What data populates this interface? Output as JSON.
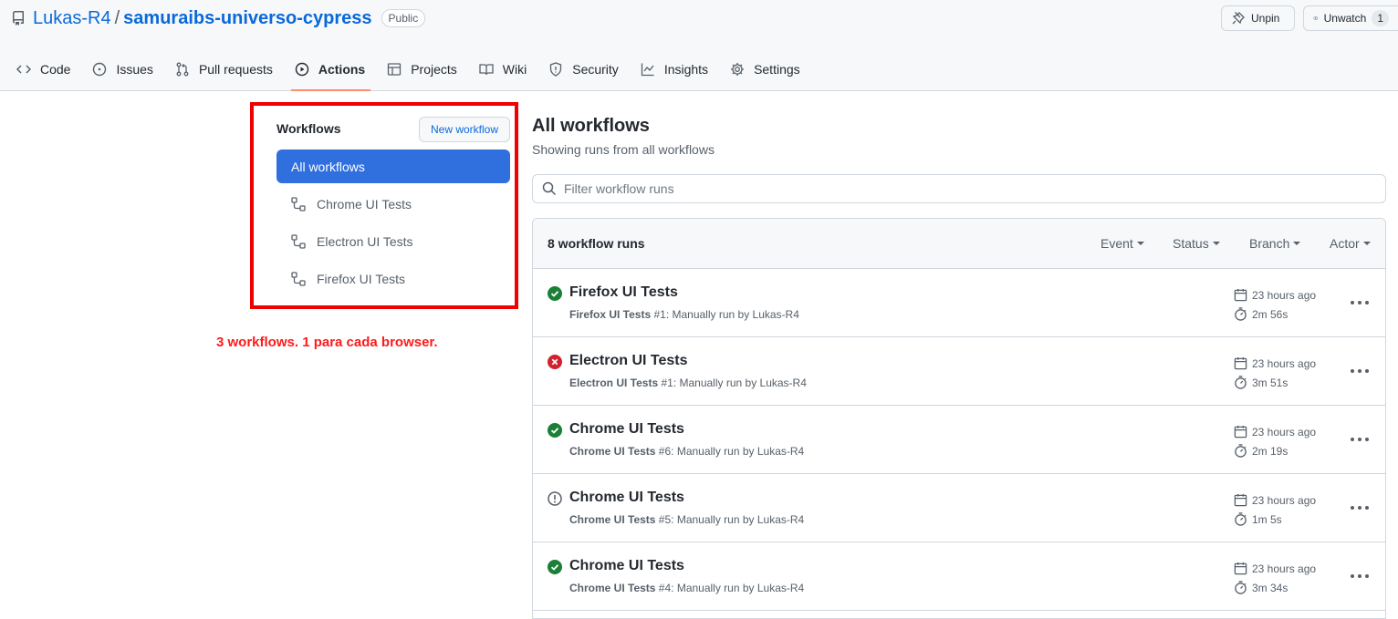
{
  "repo": {
    "owner": "Lukas-R4",
    "separator": "/",
    "name": "samuraibs-universo-cypress",
    "visibility": "Public"
  },
  "header_actions": {
    "unpin_label": "Unpin",
    "unwatch_label": "Unwatch",
    "watch_count": "1"
  },
  "nav": {
    "code": "Code",
    "issues": "Issues",
    "pull_requests": "Pull requests",
    "actions": "Actions",
    "projects": "Projects",
    "wiki": "Wiki",
    "security": "Security",
    "insights": "Insights",
    "settings": "Settings",
    "active": "Actions"
  },
  "sidebar": {
    "title": "Workflows",
    "new_workflow_label": "New workflow",
    "items": [
      {
        "label": "All workflows",
        "selected": true
      },
      {
        "label": "Chrome UI Tests",
        "selected": false
      },
      {
        "label": "Electron UI Tests",
        "selected": false
      },
      {
        "label": "Firefox UI Tests",
        "selected": false
      }
    ],
    "annotation": "3 workflows. 1 para cada browser."
  },
  "main": {
    "title": "All workflows",
    "subtitle": "Showing runs from all workflows",
    "filter_placeholder": "Filter workflow runs",
    "runs_count": "8 workflow runs",
    "filters": {
      "event": "Event",
      "status": "Status",
      "branch": "Branch",
      "actor": "Actor"
    },
    "runs": [
      {
        "title": "Firefox UI Tests",
        "workflow": "Firefox UI Tests",
        "detail": " #1: Manually run by Lukas-R4",
        "time": "23 hours ago",
        "duration": "2m 56s",
        "status": "success"
      },
      {
        "title": "Electron UI Tests",
        "workflow": "Electron UI Tests",
        "detail": " #1: Manually run by Lukas-R4",
        "time": "23 hours ago",
        "duration": "3m 51s",
        "status": "failure"
      },
      {
        "title": "Chrome UI Tests",
        "workflow": "Chrome UI Tests",
        "detail": " #6: Manually run by Lukas-R4",
        "time": "23 hours ago",
        "duration": "2m 19s",
        "status": "success"
      },
      {
        "title": "Chrome UI Tests",
        "workflow": "Chrome UI Tests",
        "detail": " #5: Manually run by Lukas-R4",
        "time": "23 hours ago",
        "duration": "1m 5s",
        "status": "cancelled"
      },
      {
        "title": "Chrome UI Tests",
        "workflow": "Chrome UI Tests",
        "detail": " #4: Manually run by Lukas-R4",
        "time": "23 hours ago",
        "duration": "3m 34s",
        "status": "success"
      }
    ]
  },
  "colors": {
    "link": "#0969da",
    "selected_bg": "#2f6fde",
    "success": "#1a7f37",
    "failure": "#cf222e",
    "annotation": "#ff1a1a",
    "highlight_box": "#f00000"
  }
}
